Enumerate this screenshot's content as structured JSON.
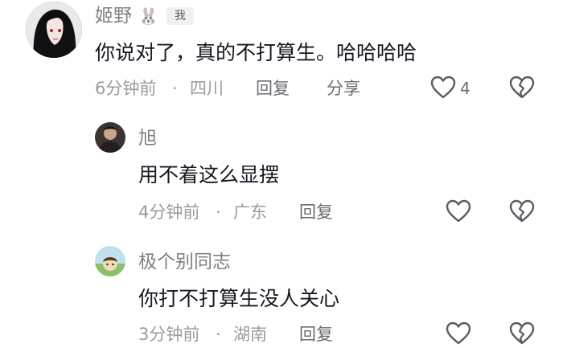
{
  "comments": [
    {
      "username": "姬野",
      "username_emoji": "🐰",
      "badge": "我",
      "text": "你说对了，真的不打算生。哈哈哈哈",
      "time": "6分钟前",
      "separator": "·",
      "location": "四川",
      "reply_label": "回复",
      "share_label": "分享",
      "like_count": "4",
      "like_icon": "heart-outline-icon",
      "dislike_icon": "broken-heart-icon"
    },
    {
      "username": "旭",
      "text": "用不着这么显摆",
      "time": "4分钟前",
      "separator": "·",
      "location": "广东",
      "reply_label": "回复",
      "like_icon": "heart-outline-icon",
      "dislike_icon": "broken-heart-icon"
    },
    {
      "username": "极个别同志",
      "text": "你打不打算生没人关心",
      "time": "3分钟前",
      "separator": "·",
      "location": "湖南",
      "reply_label": "回复",
      "like_icon": "heart-outline-icon",
      "dislike_icon": "broken-heart-icon"
    }
  ],
  "colors": {
    "username": "#7f7f86",
    "content": "#161823",
    "meta": "#9a9aa0",
    "icon_stroke": "#5a5a62"
  }
}
